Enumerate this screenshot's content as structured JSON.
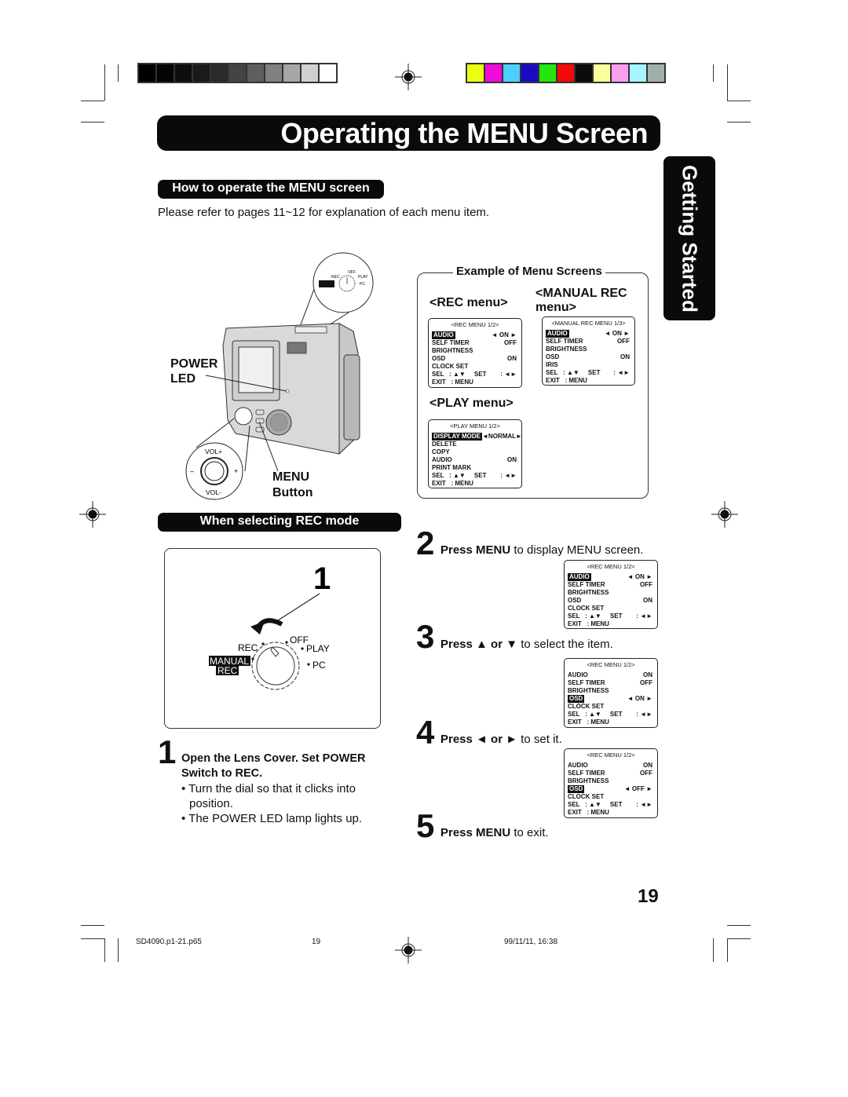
{
  "print_marks": {
    "grayscale_swatches": [
      "#000000",
      "#050505",
      "#0d0d0d",
      "#1a1a1a",
      "#2a2a2a",
      "#444444",
      "#5e5e5e",
      "#808080",
      "#a6a6a6",
      "#d0d0d0",
      "#ffffff"
    ],
    "color_swatches": [
      "#eaff12",
      "#ef0bd8",
      "#4bd0ff",
      "#1a0ac4",
      "#22e60c",
      "#f20a0a",
      "#0a0c0b",
      "#faff9a",
      "#ff9ef0",
      "#a6f4ff",
      "#a0aeae"
    ]
  },
  "header": {
    "title": "Operating the MENU Screen",
    "side_tab": "Getting Started"
  },
  "section_how": {
    "heading": "How to operate the MENU screen",
    "intro": "Please refer to pages 11~12 for explanation of each menu item."
  },
  "camera_diagram": {
    "power_led_label_line1": "POWER",
    "power_led_label_line2": "LED",
    "menu_button_label_line1": "MENU",
    "menu_button_label_line2": "Button",
    "vol_plus": "VOL+",
    "vol_minus": "VOL-",
    "minus": "–",
    "plus": "+",
    "inset_dial": {
      "rec": "REC",
      "off": "OFF",
      "play": "PLAY",
      "pc": "PC",
      "manual": "MANUAL",
      "manual_rec": "REC"
    }
  },
  "examples": {
    "legend": "Example of Menu Screens",
    "rec_menu_heading": "<REC menu>",
    "manual_rec_heading_line1": "<MANUAL REC",
    "manual_rec_heading_line2": "menu>",
    "play_menu_heading": "<PLAY menu>",
    "rec_menu": {
      "title": "<REC MENU 1/2>",
      "rows": [
        {
          "label": "AUDIO",
          "value": "◄ ON ►",
          "highlight": true
        },
        {
          "label": "SELF TIMER",
          "value": "OFF",
          "highlight": false
        },
        {
          "label": "BRIGHTNESS",
          "value": "",
          "highlight": false
        },
        {
          "label": "OSD",
          "value": "ON",
          "highlight": false
        },
        {
          "label": "CLOCK SET",
          "value": "",
          "highlight": false
        },
        {
          "label": "SEL   : ▲▼     SET",
          "value": ": ◄►",
          "highlight": false
        },
        {
          "label": "EXIT   : MENU",
          "value": "",
          "highlight": false
        }
      ]
    },
    "manual_rec_menu": {
      "title": "<MANUAL REC MENU 1/3>",
      "rows": [
        {
          "label": "AUDIO",
          "value": "◄ ON ►",
          "highlight": true
        },
        {
          "label": "SELF TIMER",
          "value": "OFF",
          "highlight": false
        },
        {
          "label": "BRIGHTNESS",
          "value": "",
          "highlight": false
        },
        {
          "label": "OSD",
          "value": "ON",
          "highlight": false
        },
        {
          "label": "IRIS",
          "value": "",
          "highlight": false
        },
        {
          "label": "SEL   : ▲▼     SET",
          "value": ": ◄►",
          "highlight": false
        },
        {
          "label": "EXIT   : MENU",
          "value": "",
          "highlight": false
        }
      ]
    },
    "play_menu": {
      "title": "<PLAY MENU 1/2>",
      "rows": [
        {
          "label": "DISPLAY MODE",
          "value": "◄NORMAL►",
          "highlight": true
        },
        {
          "label": "DELETE",
          "value": "",
          "highlight": false
        },
        {
          "label": "COPY",
          "value": "",
          "highlight": false
        },
        {
          "label": "AUDIO",
          "value": "ON",
          "highlight": false
        },
        {
          "label": "PRINT MARK",
          "value": "",
          "highlight": false
        },
        {
          "label": "SEL   : ▲▼     SET",
          "value": ": ◄►",
          "highlight": false
        },
        {
          "label": "EXIT   : MENU",
          "value": "",
          "highlight": false
        }
      ]
    }
  },
  "section_rec": {
    "heading": "When selecting REC mode",
    "callout_number": "1",
    "dial": {
      "rec": "REC",
      "off": "OFF",
      "play": "PLAY",
      "pc": "PC",
      "manual": "MANUAL",
      "manual_rec": "REC"
    }
  },
  "steps": [
    {
      "number": "1",
      "title": "Open the Lens Cover. Set POWER Switch to REC.",
      "bullets": [
        "Turn the dial so that it clicks into position.",
        "The POWER LED lamp lights up."
      ]
    },
    {
      "number": "2",
      "bold": "Press MENU",
      "rest": " to display MENU screen.",
      "menu": {
        "title": "<REC MENU 1/2>",
        "rows": [
          {
            "label": "AUDIO",
            "value": "◄ ON ►",
            "highlight": true
          },
          {
            "label": "SELF TIMER",
            "value": "OFF",
            "highlight": false
          },
          {
            "label": "BRIGHTNESS",
            "value": "",
            "highlight": false
          },
          {
            "label": "OSD",
            "value": "ON",
            "highlight": false
          },
          {
            "label": "CLOCK SET",
            "value": "",
            "highlight": false
          },
          {
            "label": "SEL   : ▲▼     SET",
            "value": ": ◄►",
            "highlight": false
          },
          {
            "label": "EXIT   : MENU",
            "value": "",
            "highlight": false
          }
        ]
      }
    },
    {
      "number": "3",
      "bold": "Press ▲ or ▼",
      "rest": " to select the item.",
      "menu": {
        "title": "<REC MENU 1/2>",
        "rows": [
          {
            "label": "AUDIO",
            "value": "ON",
            "highlight": false
          },
          {
            "label": "SELF TIMER",
            "value": "OFF",
            "highlight": false
          },
          {
            "label": "BRIGHTNESS",
            "value": "",
            "highlight": false
          },
          {
            "label": "OSD",
            "value": "◄ ON ►",
            "highlight": true
          },
          {
            "label": "CLOCK SET",
            "value": "",
            "highlight": false
          },
          {
            "label": "SEL   : ▲▼     SET",
            "value": ": ◄►",
            "highlight": false
          },
          {
            "label": "EXIT   : MENU",
            "value": "",
            "highlight": false
          }
        ]
      }
    },
    {
      "number": "4",
      "bold": "Press ◄ or ►",
      "rest": " to set it.",
      "menu": {
        "title": "<REC MENU 1/2>",
        "rows": [
          {
            "label": "AUDIO",
            "value": "ON",
            "highlight": false
          },
          {
            "label": "SELF TIMER",
            "value": "OFF",
            "highlight": false
          },
          {
            "label": "BRIGHTNESS",
            "value": "",
            "highlight": false
          },
          {
            "label": "OSD",
            "value": "◄ OFF ►",
            "highlight": true
          },
          {
            "label": "CLOCK SET",
            "value": "",
            "highlight": false
          },
          {
            "label": "SEL   : ▲▼     SET",
            "value": ": ◄►",
            "highlight": false
          },
          {
            "label": "EXIT   : MENU",
            "value": "",
            "highlight": false
          }
        ]
      }
    },
    {
      "number": "5",
      "bold": "Press MENU",
      "rest": " to exit."
    }
  ],
  "page_number": "19",
  "footer": {
    "file": "SD4090.p1-21.p65",
    "page": "19",
    "timestamp": "99/11/11, 16:38"
  }
}
